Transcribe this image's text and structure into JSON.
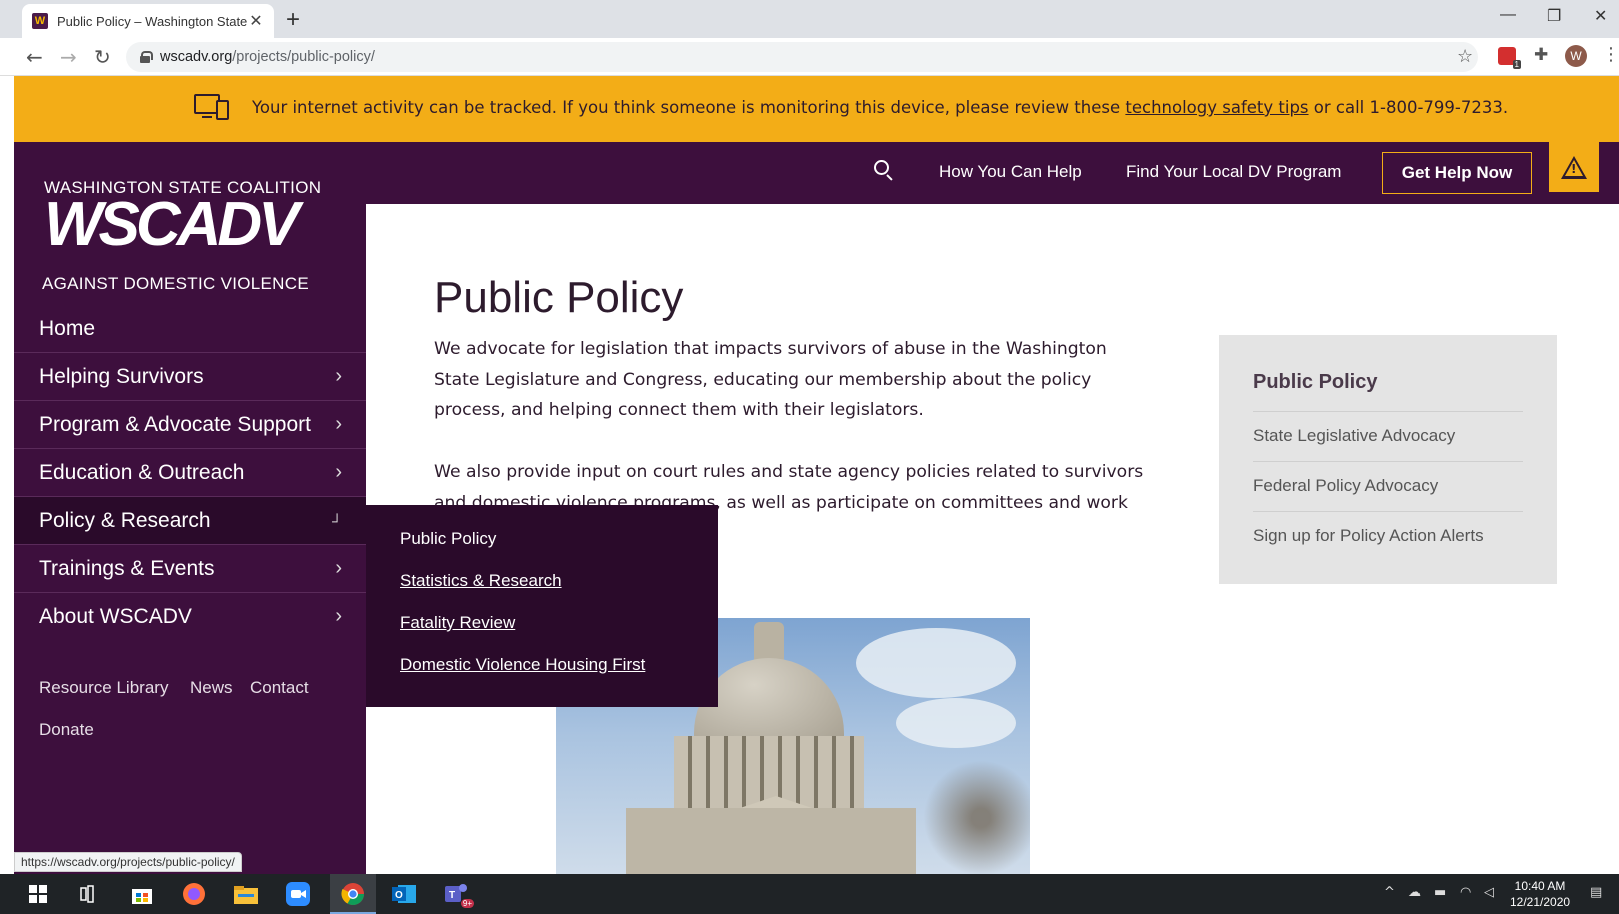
{
  "browser": {
    "tab_title": "Public Policy – Washington State",
    "favicon_letter": "W",
    "url_host": "wscadv.org",
    "url_path": "/projects/public-policy/",
    "avatar_letter": "W",
    "ext_badge": "1",
    "status_url": "https://wscadv.org/projects/public-policy/"
  },
  "safety_banner": {
    "text_before": "Your internet activity can be tracked. If you think someone is monitoring this device, please review these",
    "link": "technology safety tips",
    "text_after": "or call 1-800-799-7233."
  },
  "header": {
    "nav": [
      "How You Can Help",
      "Find Your Local DV Program"
    ],
    "get_help": "Get Help Now"
  },
  "logo": {
    "top": "WASHINGTON STATE COALITION",
    "main": "WSCADV",
    "bottom": "AGAINST DOMESTIC VIOLENCE"
  },
  "sidebar": {
    "items": [
      {
        "label": "Home"
      },
      {
        "label": "Helping Survivors"
      },
      {
        "label": "Program & Advocate Support"
      },
      {
        "label": "Education & Outreach"
      },
      {
        "label": "Policy & Research"
      },
      {
        "label": "Trainings & Events"
      },
      {
        "label": "About WSCADV"
      }
    ],
    "utility": [
      "Resource Library",
      "News",
      "Contact",
      "Donate"
    ]
  },
  "dropdown": {
    "items": [
      "Public Policy",
      "Statistics & Research",
      "Fatality Review",
      "Domestic Violence Housing First"
    ]
  },
  "main": {
    "title": "Public Policy",
    "para1": "We advocate for legislation that impacts survivors of abuse in the Washington State Legislature and Congress, educating our membership about the policy process, and helping connect them with their legislators.",
    "para2": "We also provide input on court rules and state agency policies related to survivors and domestic violence programs, as well as participate on committees and work groups on social justice issues."
  },
  "sidecard": {
    "title": "Public Policy",
    "links": [
      "State Legislative Advocacy",
      "Federal Policy Advocacy",
      "Sign up for Policy Action Alerts"
    ]
  },
  "taskbar": {
    "time": "10:40 AM",
    "date": "12/21/2020",
    "teams_badge": "9+"
  },
  "colors": {
    "purple": "#3d0f3d",
    "purple_dark": "#2a0a2a",
    "gold": "#f3ad17"
  }
}
